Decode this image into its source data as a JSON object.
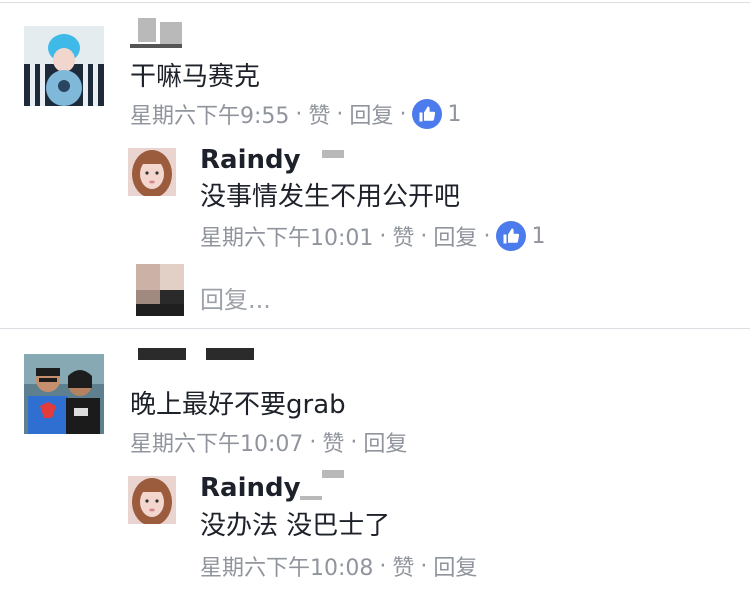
{
  "colors": {
    "like_badge": "#4b7bec",
    "meta_text": "#90949c",
    "divider": "#dcdee3"
  },
  "comments": [
    {
      "text": "干嘛马赛克",
      "meta": {
        "time": "星期六下午9:55",
        "sep": "·",
        "like": "赞",
        "reply": "回复",
        "like_count": "1"
      },
      "reply": {
        "name": "Raindy",
        "text": "没事情发生不用公开吧",
        "meta": {
          "time": "星期六下午10:01",
          "sep": "·",
          "like": "赞",
          "reply": "回复",
          "like_count": "1"
        }
      },
      "reply_input": {
        "placeholder": "回复..."
      }
    },
    {
      "text": "晚上最好不要grab",
      "meta": {
        "time": "星期六下午10:07",
        "sep": "·",
        "like": "赞",
        "reply": "回复"
      },
      "reply": {
        "name": "Raindy",
        "text": "没办法 没巴士了",
        "meta": {
          "time": "星期六下午10:08",
          "sep": "·",
          "like": "赞",
          "reply": "回复"
        }
      }
    }
  ]
}
